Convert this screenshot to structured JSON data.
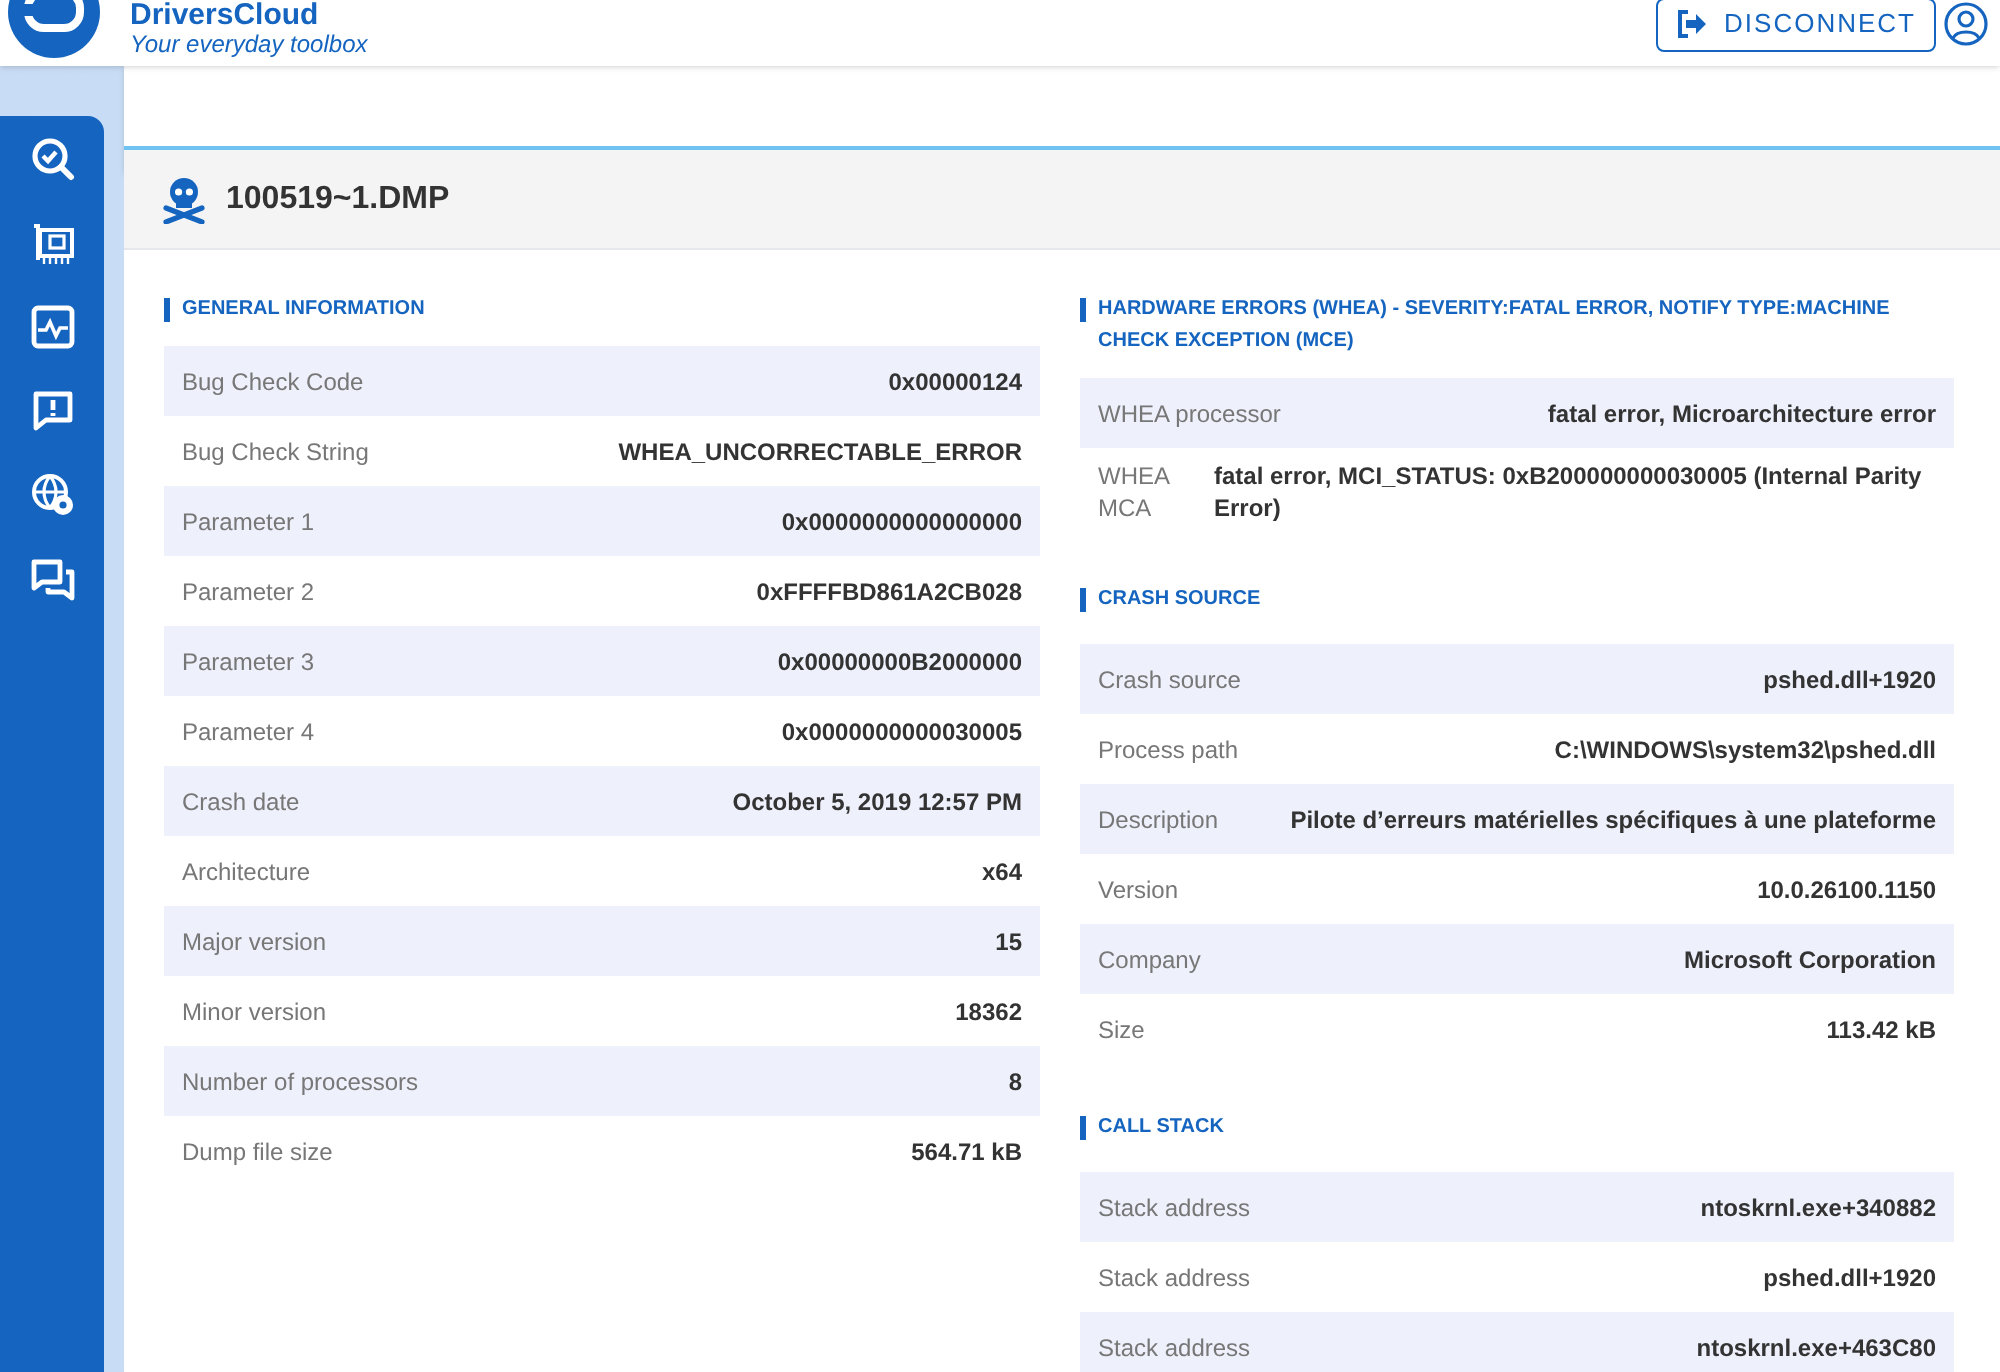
{
  "header": {
    "app_name": "DriversCloud",
    "tagline": "Your everyday toolbox",
    "disconnect_button": "DISCONNECT"
  },
  "sidebar": {
    "items": [
      {
        "kind": "search-check"
      },
      {
        "kind": "card"
      },
      {
        "kind": "monitor"
      },
      {
        "kind": "alert"
      },
      {
        "kind": "globe-gear"
      },
      {
        "kind": "chat"
      }
    ]
  },
  "dump": {
    "title": "100519~1.DMP",
    "general": {
      "heading": "GENERAL INFORMATION",
      "rows": [
        {
          "label": "Bug Check Code",
          "value": "0x00000124"
        },
        {
          "label": "Bug Check String",
          "value": "WHEA_UNCORRECTABLE_ERROR"
        },
        {
          "label": "Parameter 1",
          "value": "0x0000000000000000"
        },
        {
          "label": "Parameter 2",
          "value": "0xFFFFBD861A2CB028"
        },
        {
          "label": "Parameter 3",
          "value": "0x00000000B2000000"
        },
        {
          "label": "Parameter 4",
          "value": "0x0000000000030005"
        },
        {
          "label": "Crash date",
          "value": "October 5, 2019 12:57 PM"
        },
        {
          "label": "Architecture",
          "value": "x64"
        },
        {
          "label": "Major version",
          "value": "15"
        },
        {
          "label": "Minor version",
          "value": "18362"
        },
        {
          "label": "Number of processors",
          "value": "8"
        },
        {
          "label": "Dump file size",
          "value": "564.71 kB"
        }
      ]
    },
    "sections": [
      {
        "heading": "HARDWARE ERRORS (WHEA) - SEVERITY:FATAL ERROR, NOTIFY TYPE:MACHINE CHECK EXCEPTION (MCE)",
        "rows": [
          {
            "label": "WHEA processor",
            "value": "fatal error, Microarchitecture error"
          },
          {
            "label": "WHEA MCA",
            "value": "fatal error, MCI_STATUS: 0xB200000000030005 (Internal Parity Error)",
            "kind": "wrap"
          }
        ]
      },
      {
        "heading": "CRASH SOURCE",
        "rows": [
          {
            "label": "Crash source",
            "value": "pshed.dll+1920"
          },
          {
            "label": "Process path",
            "value": "C:\\WINDOWS\\system32\\pshed.dll"
          },
          {
            "label": "Description",
            "value": "Pilote d’erreurs matérielles spécifiques à une plateforme"
          },
          {
            "label": "Version",
            "value": "10.0.26100.1150"
          },
          {
            "label": "Company",
            "value": "Microsoft Corporation"
          },
          {
            "label": "Size",
            "value": "113.42 kB"
          }
        ]
      },
      {
        "heading": "CALL STACK",
        "rows": [
          {
            "label": "Stack address",
            "value": "ntoskrnl.exe+340882"
          },
          {
            "label": "Stack address",
            "value": "pshed.dll+1920"
          },
          {
            "label": "Stack address",
            "value": "ntoskrnl.exe+463C80"
          }
        ]
      }
    ]
  }
}
